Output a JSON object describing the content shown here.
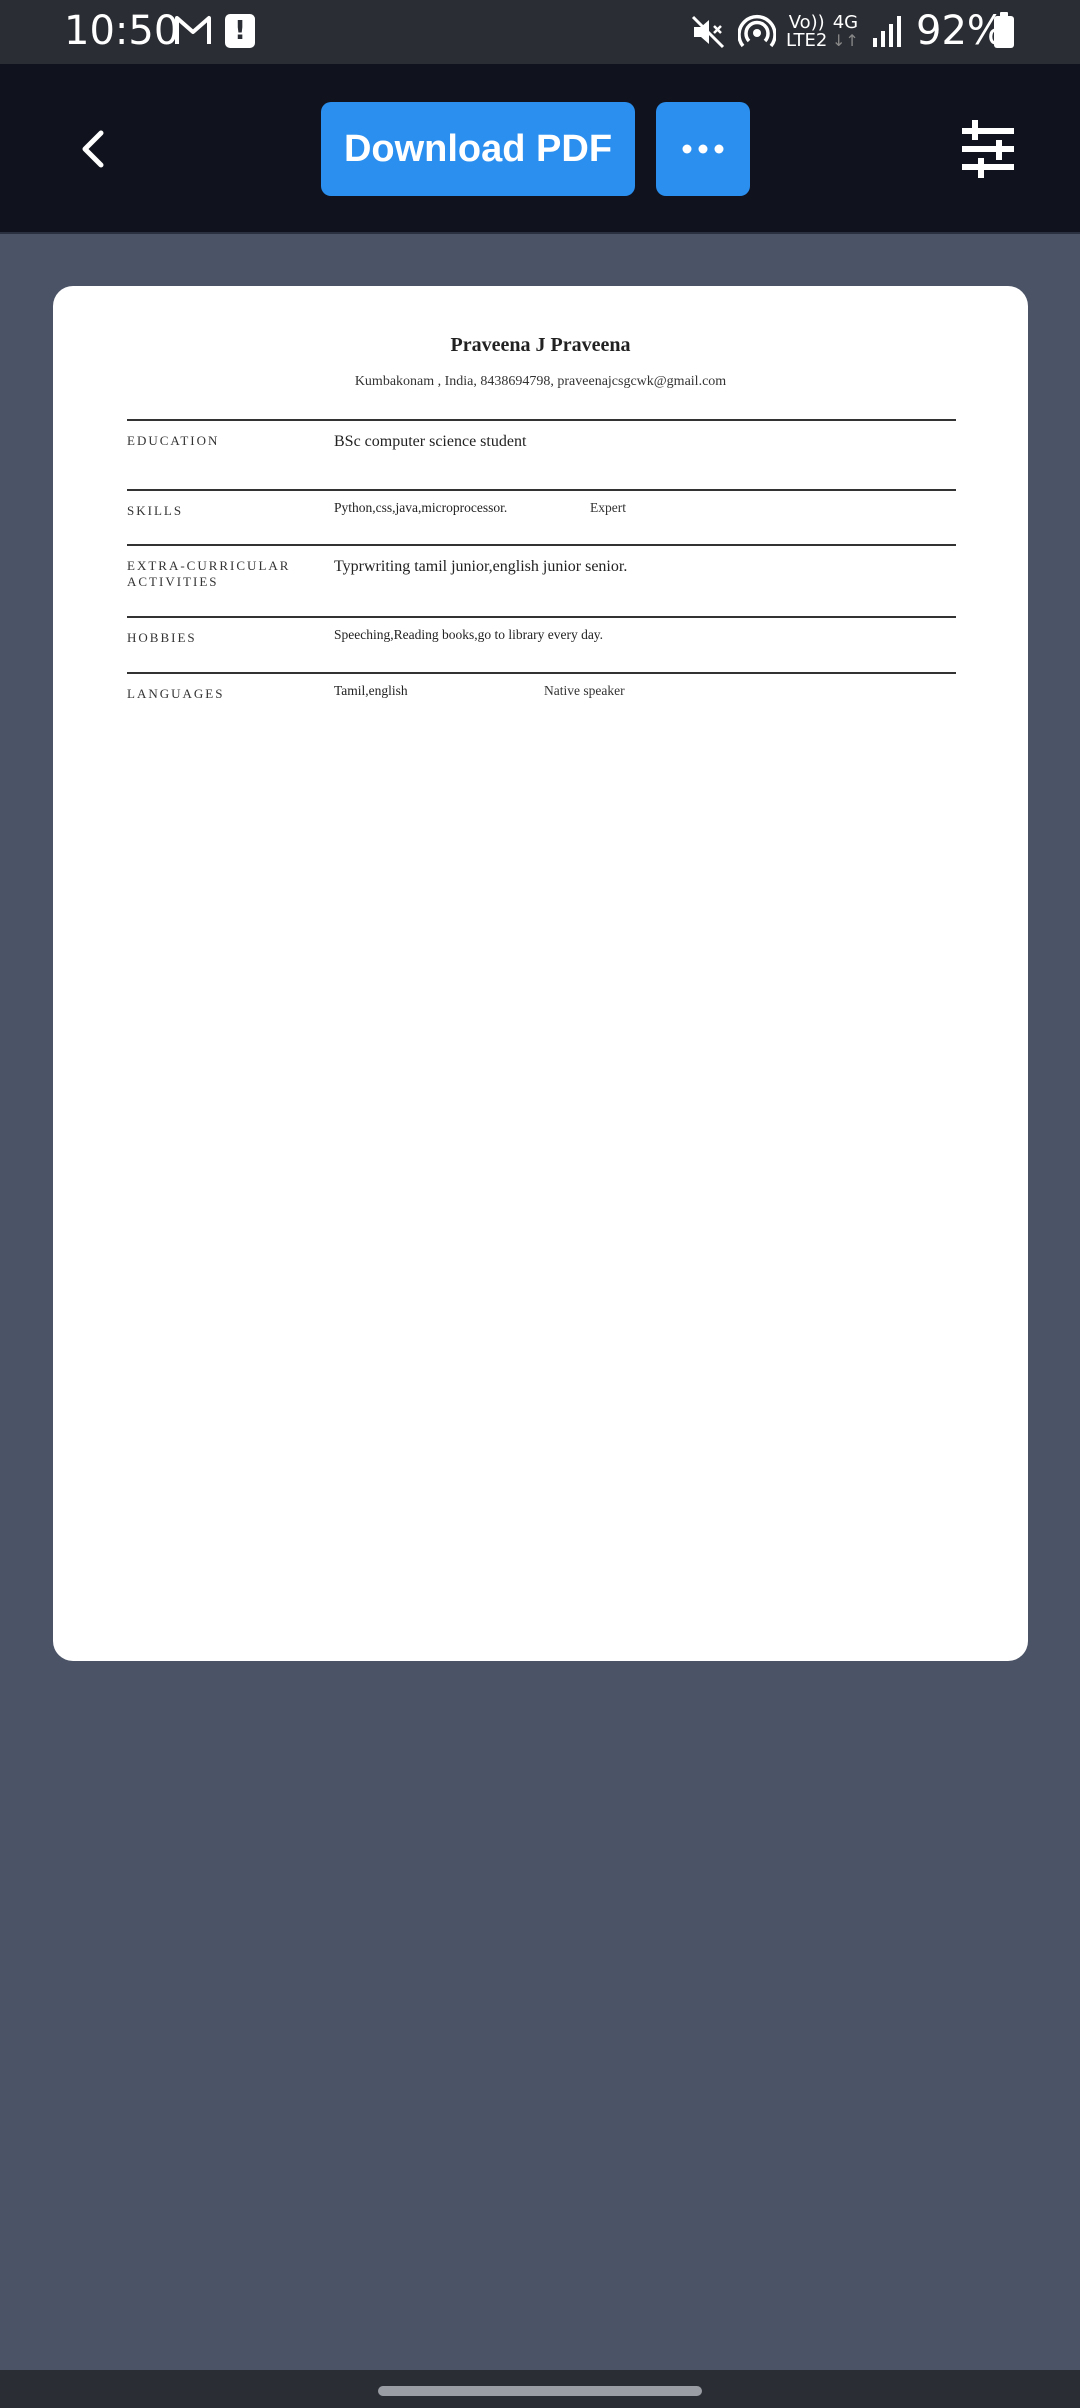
{
  "status_bar": {
    "time": "10:50",
    "network_top": "Vo))",
    "network_bottom": "LTE2",
    "data_type": "4G",
    "data_arrows": "↓↑",
    "battery": "92%"
  },
  "toolbar": {
    "download_label": "Download PDF",
    "icons": [
      "back-arrow-icon",
      "more-dots-icon",
      "filter-sliders-icon"
    ],
    "accent_color": "#2b8ff0"
  },
  "resume": {
    "name": "Praveena J Praveena",
    "contact": "Kumbakonam , India, 8438694798, praveenajcsgcwk@gmail.com",
    "sections": {
      "education": {
        "label": "EDUCATION",
        "value": "BSc computer science student"
      },
      "skills": {
        "label": "SKILLS",
        "value": "Python,css,java,microprocessor.",
        "level": "Expert"
      },
      "extra": {
        "label_line1": "EXTRA-CURRICULAR",
        "label_line2": "ACTIVITIES",
        "value": "Typrwriting tamil junior,english junior senior."
      },
      "hobbies": {
        "label": "HOBBIES",
        "value": "Speeching,Reading books,go to library every day."
      },
      "languages": {
        "label": "LANGUAGES",
        "value": "Tamil,english",
        "level": "Native speaker"
      }
    }
  }
}
